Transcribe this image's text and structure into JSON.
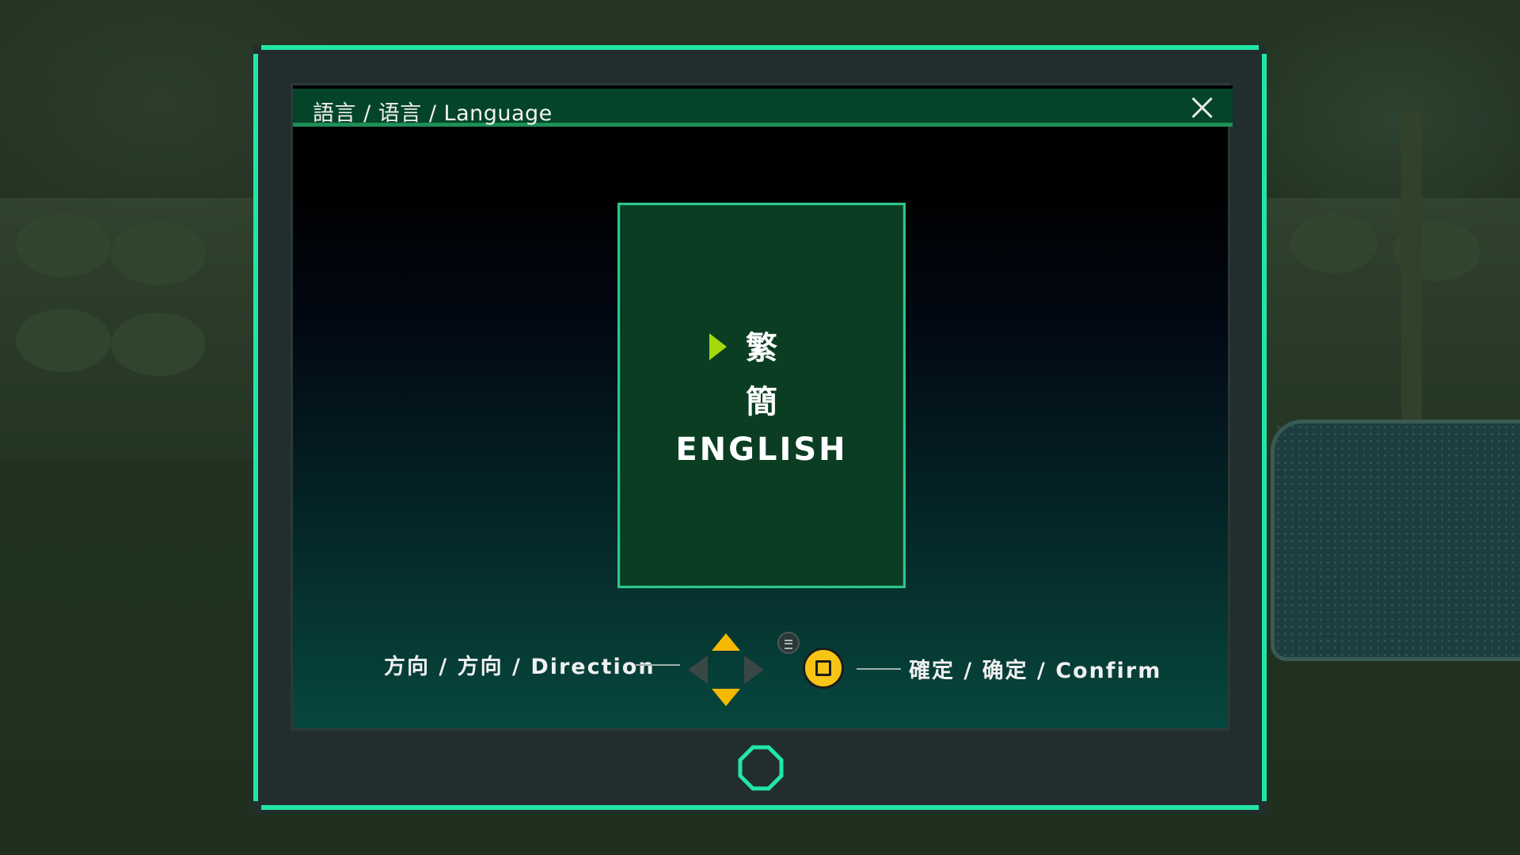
{
  "dialog": {
    "title": "語言 / 语言 / Language",
    "close_icon": "close-icon"
  },
  "language_options": [
    {
      "label": "繁",
      "selected": true
    },
    {
      "label": "簡",
      "selected": false
    },
    {
      "label": "ENGLISH",
      "selected": false
    }
  ],
  "controls": {
    "direction_label": "方向 / 方向 / Direction",
    "direction_icon": "dpad-icon",
    "menu_icon": "menu-button-icon",
    "confirm_label": "確定 / 确定 / Confirm",
    "confirm_icon": "square-button-icon"
  },
  "colors": {
    "frame_accent": "#22e6a6",
    "titlebar": "#04452a",
    "panel": "#0a3d22",
    "cursor": "#a6d80e",
    "button_yellow": "#f7c516"
  }
}
